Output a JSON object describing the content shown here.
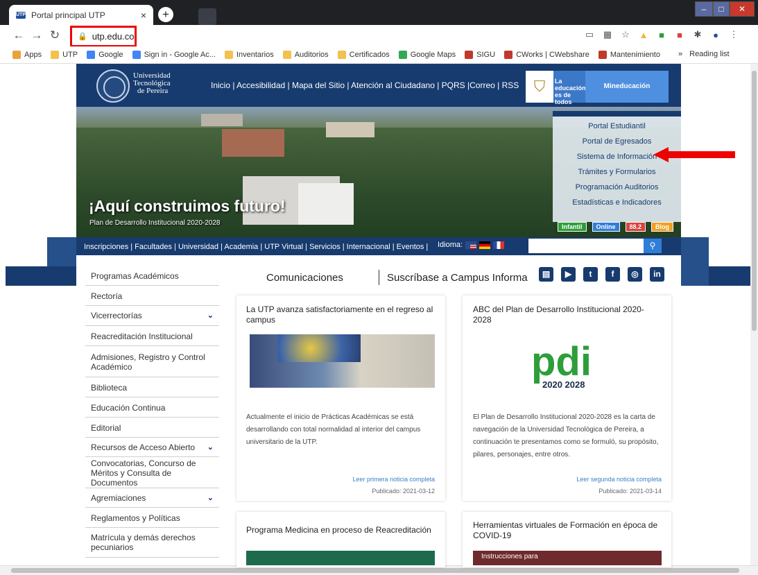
{
  "browser": {
    "tab_title": "Portal principal UTP",
    "tab_favicon": "UTP",
    "close": "×",
    "new_tab": "+",
    "url": "utp.edu.co",
    "bookmarks": [
      {
        "label": "Apps",
        "color": "#e8a33c"
      },
      {
        "label": "UTP",
        "color": "#f2c14e"
      },
      {
        "label": "Google",
        "color": "#4285f4"
      },
      {
        "label": "Sign in - Google Ac...",
        "color": "#4285f4"
      },
      {
        "label": "Inventarios",
        "color": "#f2c14e"
      },
      {
        "label": "Auditorios",
        "color": "#f2c14e"
      },
      {
        "label": "Certificados",
        "color": "#f2c14e"
      },
      {
        "label": "Google Maps",
        "color": "#34a853"
      },
      {
        "label": "SIGU",
        "color": "#c0392b"
      },
      {
        "label": "CWorks | CWebshare",
        "color": "#c0392b"
      },
      {
        "label": "Mantenimiento",
        "color": "#c0392b"
      }
    ],
    "more": "»",
    "reading_list": "Reading list"
  },
  "header": {
    "logo_line1": "Universidad",
    "logo_line2": "Tecnológica",
    "logo_line3": "de Pereira",
    "top_links": "Inicio | Accesibilidad | Mapa del Sitio | Atención al Ciudadano | PQRS |Correo | RSS",
    "gov_line1": "La educación",
    "gov_line2": "es de todos",
    "gov_brand": "Mineducación"
  },
  "hero": {
    "slogan": "¡Aquí construimos futuro!",
    "plan": "Plan de Desarrollo Institucional 2020-2028"
  },
  "portal_menu": [
    "Portal Estudiantil",
    "Portal de Egresados",
    "Sistema de Información",
    "Trámites y Formularios",
    "Programación Auditorios",
    "Estadísticas e Indicadores"
  ],
  "badges": [
    {
      "label": "Infantil",
      "color": "#2e9e3a"
    },
    {
      "label": "Online",
      "color": "#2f7ed8"
    },
    {
      "label": "88.2",
      "color": "#d9433b"
    },
    {
      "label": "Blog",
      "color": "#f0a020"
    }
  ],
  "nav": {
    "links": "Inscripciones | Facultades | Universidad | Academia | UTP Virtual | Servicios | Internacional | Eventos |",
    "idioma": "Idioma:",
    "search_icon": "search-icon"
  },
  "sidebar": [
    {
      "label": "Programas Académicos",
      "chevron": false
    },
    {
      "label": "Rectoría",
      "chevron": false
    },
    {
      "label": "Vicerrectorías",
      "chevron": true
    },
    {
      "label": "Reacreditación Institucional",
      "chevron": false
    },
    {
      "label": "Admisiones, Registro y Control Académico",
      "chevron": false
    },
    {
      "label": "Biblioteca",
      "chevron": false
    },
    {
      "label": "Educación Continua",
      "chevron": false
    },
    {
      "label": "Editorial",
      "chevron": false
    },
    {
      "label": "Recursos de Acceso Abierto",
      "chevron": true
    },
    {
      "label": "Convocatorias, Concurso de Méritos y Consulta de Documentos",
      "chevron": false
    },
    {
      "label": "Agremiaciones",
      "chevron": true
    },
    {
      "label": "Reglamentos y Políticas",
      "chevron": false
    },
    {
      "label": "Matrícula y demás derechos pecuniarios",
      "chevron": false
    }
  ],
  "content": {
    "comunicaciones": "Comunicaciones",
    "suscribase": "Suscríbase a Campus Informa",
    "social": [
      "news-icon",
      "youtube-icon",
      "twitter-icon",
      "facebook-icon",
      "instagram-icon",
      "linkedin-icon"
    ],
    "cards": [
      {
        "title": "La UTP avanza satisfactoriamente en el regreso al campus",
        "body": "Actualmente el inicio de Prácticas Académicas se está desarrollando con total normalidad al interior del campus universitario de la UTP.",
        "link": "Leer primera noticia completa",
        "date": "Publicado: 2021-03-12"
      },
      {
        "title": "ABC del Plan de Desarrollo Institucional 2020-2028",
        "body": "El Plan de Desarrollo Institucional 2020-2028 es la carta de navegación de la Universidad Tecnológica de Pereira, a continuación te presentamos como se formuló, su propósito, pilares, personajes, entre otros.",
        "link": "Leer segunda noticia completa",
        "date": "Publicado: 2021-03-14",
        "logo_text": "pdi",
        "logo_years": "2020 2028"
      },
      {
        "title": "Programa Medicina en proceso de Reacreditación"
      },
      {
        "title": "Herramientas virtuales de Formación en época de COVID-19",
        "banner": "Instrucciones para"
      }
    ]
  }
}
